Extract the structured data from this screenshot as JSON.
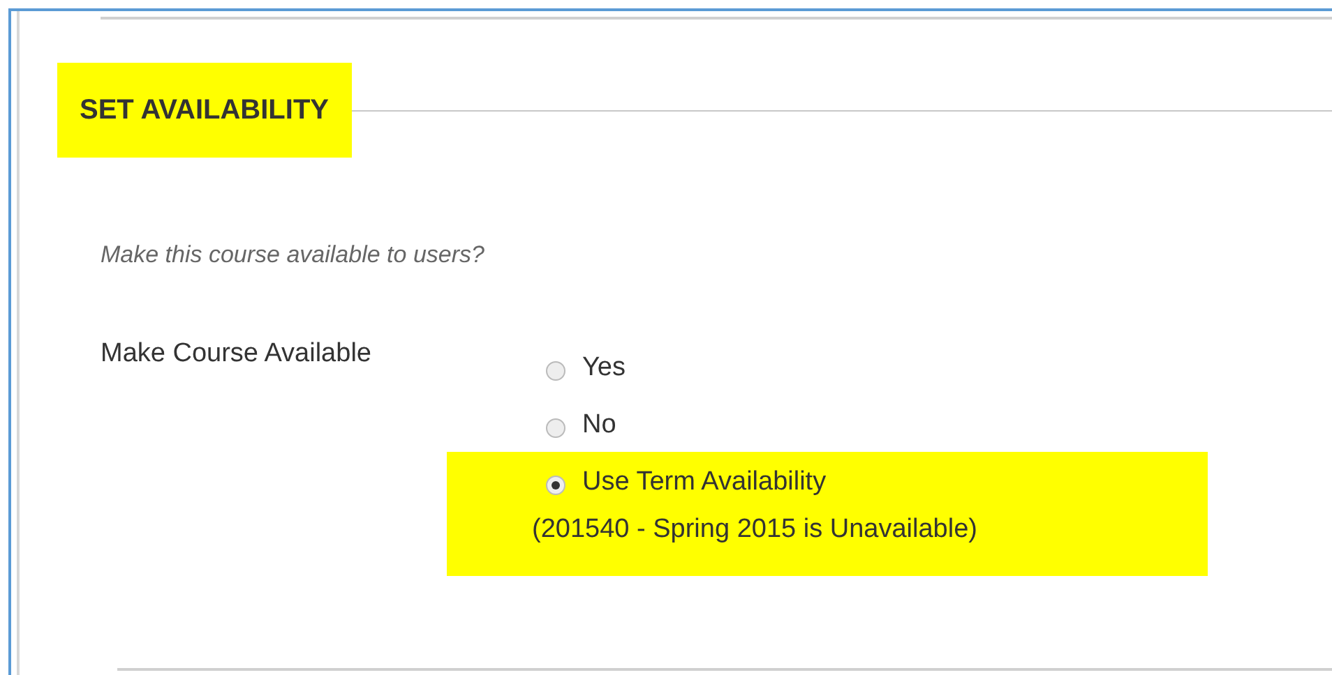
{
  "section": {
    "title": "SET AVAILABILITY",
    "highlighted": true
  },
  "prompt": "Make this course available to users?",
  "field": {
    "label": "Make Course Available",
    "options": [
      {
        "label": "Yes",
        "selected": false,
        "highlighted": false
      },
      {
        "label": "No",
        "selected": false,
        "highlighted": false
      },
      {
        "label": "Use Term Availability",
        "selected": true,
        "highlighted": true,
        "note": "(201540 - Spring 2015 is Unavailable)"
      }
    ]
  }
}
